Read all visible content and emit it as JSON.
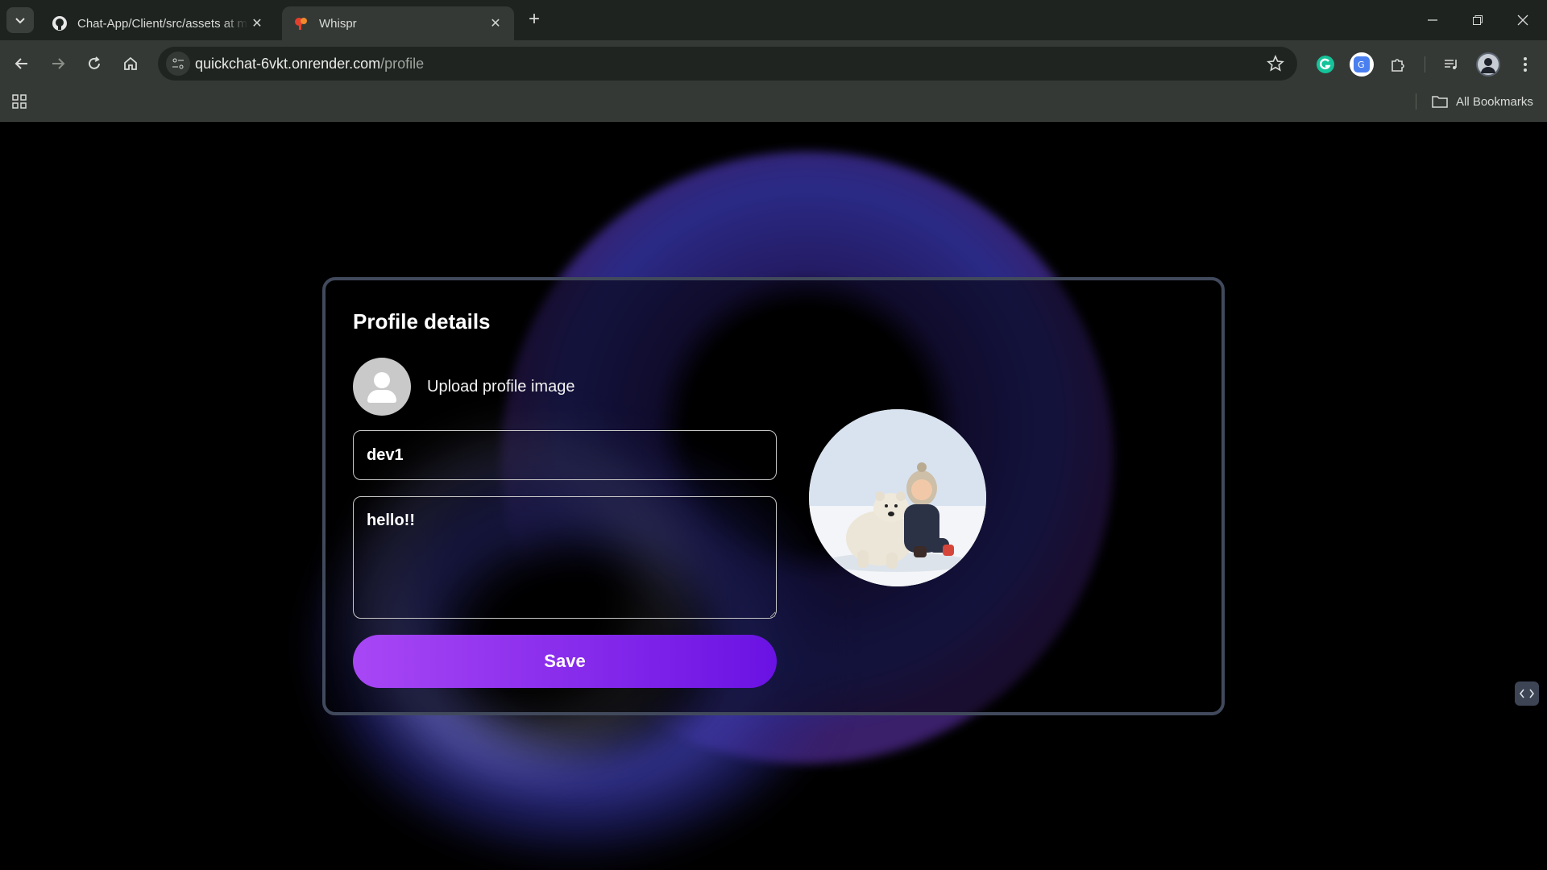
{
  "browser": {
    "tabs": [
      {
        "title": "Chat-App/Client/src/assets at main",
        "favicon": "github-icon",
        "active": false
      },
      {
        "title": "Whispr",
        "favicon": "whispr-icon",
        "active": true
      }
    ],
    "url": {
      "host": "quickchat-6vkt.onrender.com",
      "path": "/profile"
    },
    "bookmarks_label": "All Bookmarks"
  },
  "profile": {
    "title": "Profile details",
    "upload_label": "Upload profile image",
    "name_value": "dev1",
    "bio_value": "hello!!",
    "save_label": "Save",
    "accent_from": "#a847f5",
    "accent_to": "#6a12e3"
  }
}
